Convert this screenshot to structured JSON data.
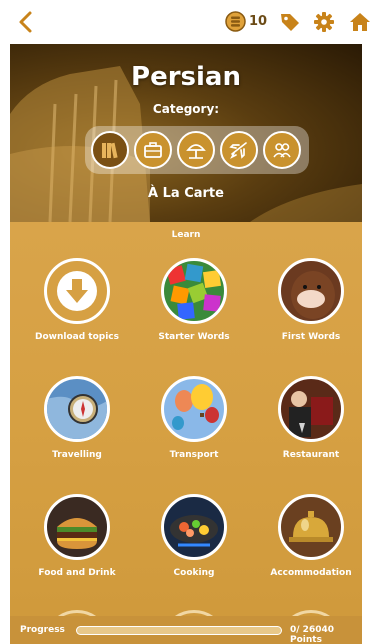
{
  "header": {
    "coins": "10",
    "icons": [
      "back-chevron-icon",
      "coin-icon",
      "tag-icon",
      "gear-icon",
      "home-icon"
    ],
    "accent_color": "#c8831a"
  },
  "hero": {
    "language": "Persian",
    "category_label": "Category:",
    "categories": [
      {
        "icon": "books-icon",
        "active": true
      },
      {
        "icon": "briefcase-icon",
        "active": false
      },
      {
        "icon": "beach-umbrella-icon",
        "active": false
      },
      {
        "icon": "airplane-icon",
        "active": false
      },
      {
        "icon": "people-icon",
        "active": false
      }
    ],
    "category_name": "À La Carte"
  },
  "content": {
    "section_label": "Learn",
    "topics": [
      {
        "label": "Download topics",
        "icon": "download-icon"
      },
      {
        "label": "Starter Words",
        "icon": "letters-image"
      },
      {
        "label": "First Words",
        "icon": "baby-image"
      },
      {
        "label": "Travelling",
        "icon": "compass-map-image"
      },
      {
        "label": "Transport",
        "icon": "hot-air-balloons-image"
      },
      {
        "label": "Restaurant",
        "icon": "restaurant-image"
      },
      {
        "label": "Food and Drink",
        "icon": "burger-image"
      },
      {
        "label": "Cooking",
        "icon": "cooking-pan-image"
      },
      {
        "label": "Accommodation",
        "icon": "hotel-bell-image"
      }
    ]
  },
  "progress": {
    "label": "Progress",
    "current": "0",
    "total_text": "/ 26040 Points",
    "fraction": 0
  }
}
